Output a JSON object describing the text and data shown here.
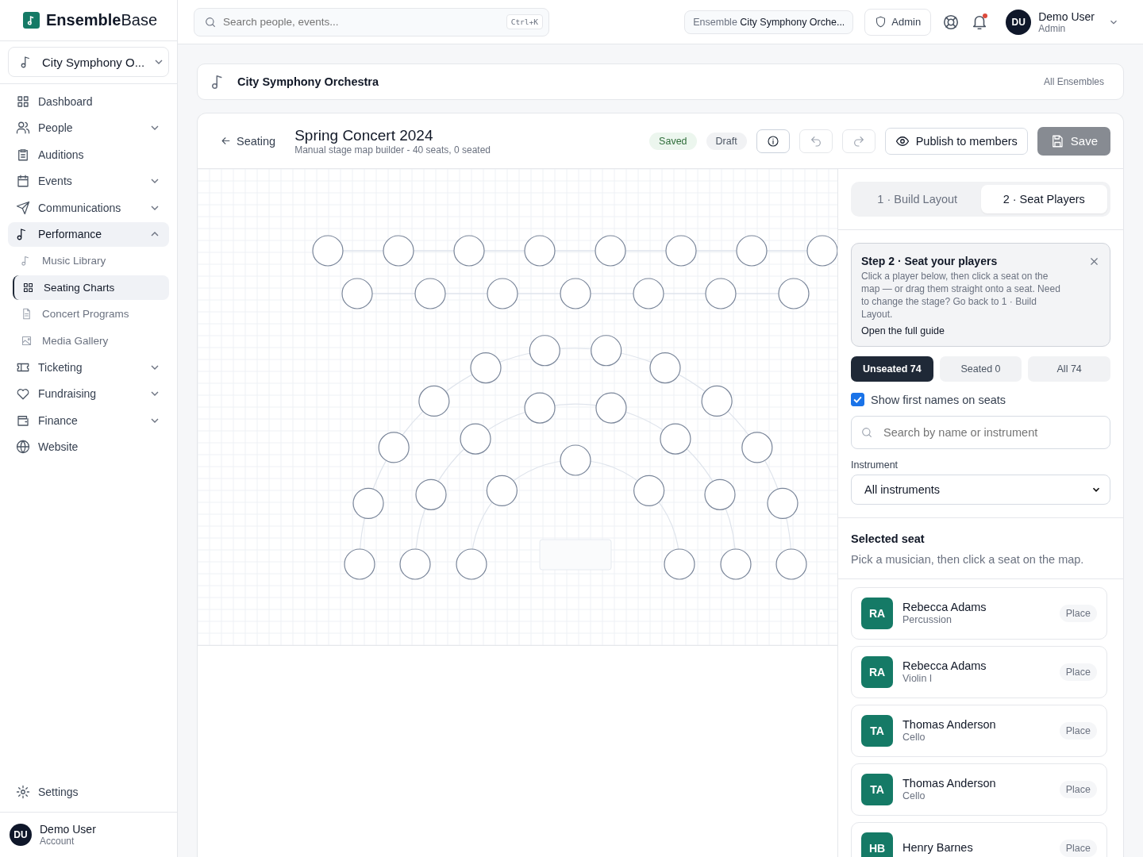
{
  "brand": {
    "name_bold": "Ensemble",
    "name_rest": "Base"
  },
  "ensemble_switcher": {
    "label": "City Symphony O..."
  },
  "sidebar": {
    "items": [
      {
        "label": "Dashboard",
        "selected": false
      },
      {
        "label": "People",
        "selected": false,
        "expanded": false
      },
      {
        "label": "Auditions",
        "selected": false
      },
      {
        "label": "Events",
        "selected": false,
        "expanded": false
      },
      {
        "label": "Communications",
        "selected": false,
        "expanded": false
      },
      {
        "label": "Performance",
        "selected": true,
        "expanded": true,
        "children": [
          {
            "label": "Music Library",
            "selected": false
          },
          {
            "label": "Seating Charts",
            "selected": true
          },
          {
            "label": "Concert Programs",
            "selected": false
          },
          {
            "label": "Media Gallery",
            "selected": false
          }
        ]
      },
      {
        "label": "Ticketing",
        "selected": false,
        "expanded": false
      },
      {
        "label": "Fundraising",
        "selected": false,
        "expanded": false
      },
      {
        "label": "Finance",
        "selected": false,
        "expanded": false
      },
      {
        "label": "Website",
        "selected": false
      }
    ],
    "settings": "Settings",
    "account": {
      "initials": "DU",
      "name": "Demo User",
      "sub": "Account"
    }
  },
  "topbar": {
    "search_placeholder": "Search people, events...",
    "shortcut": "Ctrl+K",
    "ensemble_label": "Ensemble",
    "ensemble_value": "City Symphony Orche...",
    "role": "Admin",
    "notifications_unread": true,
    "user": {
      "initials": "DU",
      "name": "Demo User",
      "role": "Admin"
    }
  },
  "ensemble_bar": {
    "name": "City Symphony Orchestra",
    "link": "All Ensembles"
  },
  "editor": {
    "back": "Seating",
    "title": "Spring Concert 2024",
    "subtitle": "Manual stage map builder - 40 seats, 0 seated",
    "badges": [
      {
        "label": "Saved",
        "kind": "success"
      },
      {
        "label": "Draft",
        "kind": "neutral"
      }
    ],
    "publish": "Publish to members",
    "save": "Save",
    "save_disabled": true
  },
  "steps": [
    {
      "label": "1 · Build Layout",
      "selected": false
    },
    {
      "label": "2 · Seat Players",
      "selected": true
    }
  ],
  "guide": {
    "title": "Step 2 · Seat your players",
    "text": "Click a player below, then click a seat on the map — or drag them straight onto a seat. Need to change the stage? Go back to 1 · Build Layout.",
    "link": "Open the full guide"
  },
  "filters": [
    {
      "label": "Unseated 74",
      "selected": true
    },
    {
      "label": "Seated 0",
      "selected": false
    },
    {
      "label": "All 74",
      "selected": false
    }
  ],
  "show_first_names": {
    "label": "Show first names on seats",
    "checked": true
  },
  "player_search": {
    "placeholder": "Search by name or instrument"
  },
  "instrument_filter": {
    "label": "Instrument",
    "value": "All instruments"
  },
  "selected_seat": {
    "title": "Selected seat",
    "hint": "Pick a musician, then click a seat on the map."
  },
  "players": [
    {
      "initials": "RA",
      "name": "Rebecca Adams",
      "instrument": "Percussion",
      "action": "Place"
    },
    {
      "initials": "RA",
      "name": "Rebecca Adams",
      "instrument": "Violin I",
      "action": "Place"
    },
    {
      "initials": "TA",
      "name": "Thomas Anderson",
      "instrument": "Cello",
      "action": "Place"
    },
    {
      "initials": "TA",
      "name": "Thomas Anderson",
      "instrument": "Cello",
      "action": "Place"
    },
    {
      "initials": "HB",
      "name": "Henry Barnes",
      "action": "Place"
    }
  ]
}
